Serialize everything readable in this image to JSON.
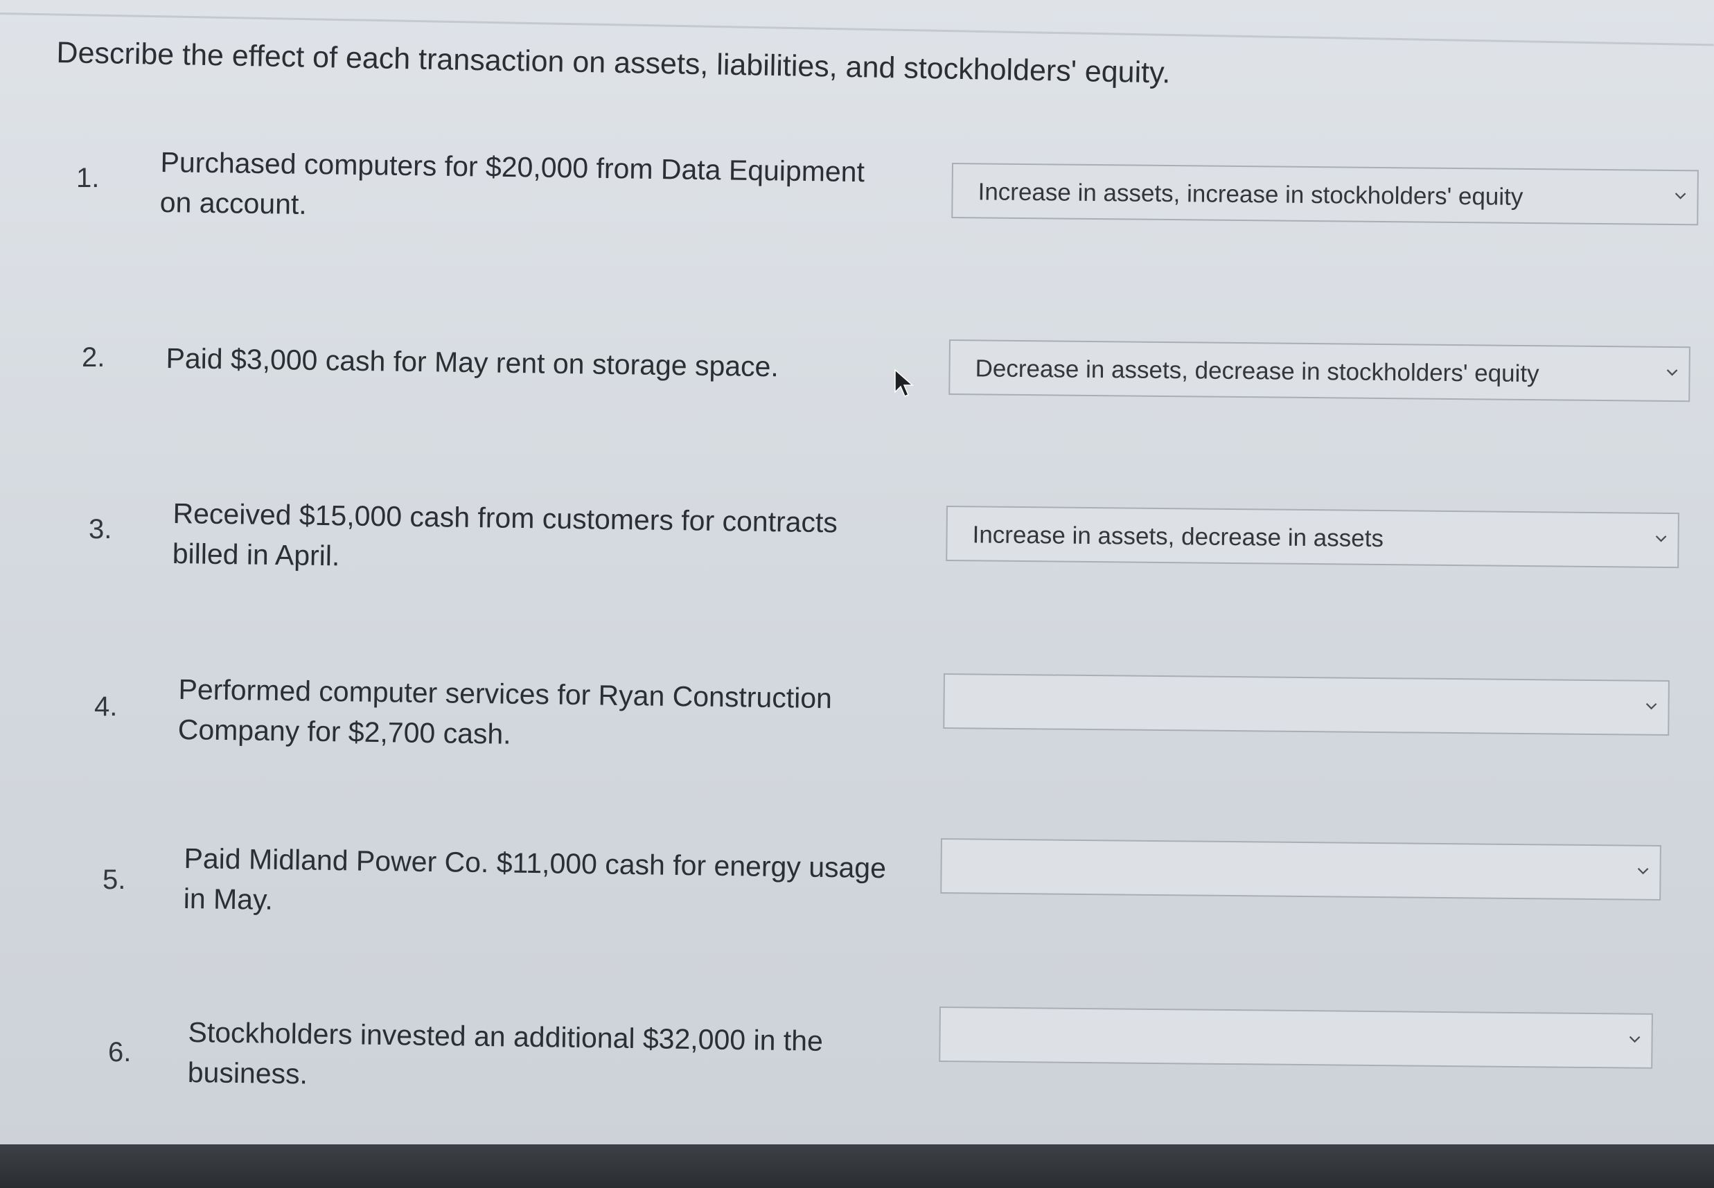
{
  "instruction": "Describe the effect of each transaction on assets, liabilities, and stockholders' equity.",
  "transactions": [
    {
      "number": "1.",
      "line1": "Purchased computers for $20,000 from Data Equipment",
      "line2": "on account.",
      "selected": "Increase in assets, increase in stockholders' equity"
    },
    {
      "number": "2.",
      "line1": "Paid $3,000 cash for May rent on storage space.",
      "line2": "",
      "selected": "Decrease in assets, decrease in stockholders' equity"
    },
    {
      "number": "3.",
      "line1": "Received $15,000 cash from customers for contracts",
      "line2": "billed in April.",
      "selected": "Increase in assets, decrease in assets"
    },
    {
      "number": "4.",
      "line1": "Performed computer services for Ryan Construction",
      "line2": "Company for $2,700 cash.",
      "selected": ""
    },
    {
      "number": "5.",
      "line1": "Paid Midland Power Co. $11,000 cash for energy usage",
      "line2": "in May.",
      "selected": ""
    },
    {
      "number": "6.",
      "line1": "Stockholders invested an additional $32,000 in the",
      "line2": "business.",
      "selected": ""
    }
  ],
  "icons": {
    "dropdown": "chevron-down-icon",
    "pointer": "mouse-cursor-icon"
  },
  "colors": {
    "background": "#d6dadf",
    "text": "#2b2e32",
    "dropdown_border": "#a9aeb4",
    "bottom_bar": "#2a2d30"
  }
}
